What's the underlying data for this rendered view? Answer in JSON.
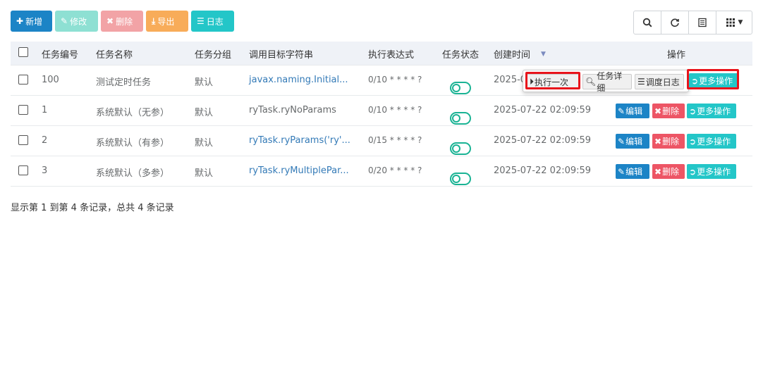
{
  "toolbar": {
    "add": "新增",
    "edit": "修改",
    "delete": "删除",
    "export": "导出",
    "log": "日志"
  },
  "table": {
    "headers": {
      "job_id": "任务编号",
      "job_name": "任务名称",
      "job_group": "任务分组",
      "invoke_target": "调用目标字符串",
      "cron": "执行表达式",
      "status": "任务状态",
      "create_time": "创建时间",
      "actions": "操作"
    },
    "rows": [
      {
        "id": "100",
        "name": "测试定时任务",
        "group": "默认",
        "target": "javax.naming.Initial...",
        "cron": "0/10 * * * * ?",
        "time": "2025-0"
      },
      {
        "id": "1",
        "name": "系统默认（无参）",
        "group": "默认",
        "target": "ryTask.ryNoParams",
        "cron": "0/10 * * * * ?",
        "time": "2025-07-22 02:09:59"
      },
      {
        "id": "2",
        "name": "系统默认（有参）",
        "group": "默认",
        "target": "ryTask.ryParams('ry'...",
        "cron": "0/15 * * * * ?",
        "time": "2025-07-22 02:09:59"
      },
      {
        "id": "3",
        "name": "系统默认（多参）",
        "group": "默认",
        "target": "ryTask.ryMultiplePar...",
        "cron": "0/20 * * * * ?",
        "time": "2025-07-22 02:09:59"
      }
    ],
    "row_actions": {
      "edit": "编辑",
      "delete": "删除",
      "more": "更多操作"
    }
  },
  "popup": {
    "run_once": "执行一次",
    "detail": "任务详细",
    "schedule_log": "调度日志"
  },
  "footer": "显示第 1 到第 4 条记录，总共 4 条记录"
}
